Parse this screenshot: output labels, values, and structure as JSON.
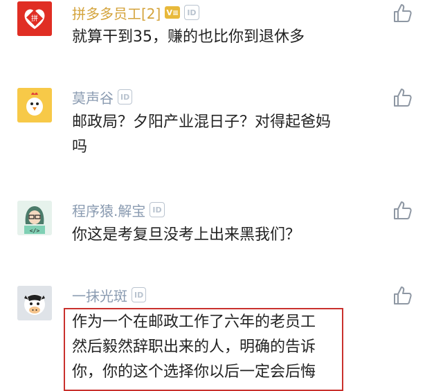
{
  "comments": [
    {
      "username": "拼多多员工[2]",
      "vip_badge": "V≡",
      "id_badge": "ID",
      "avatar_icon": "pinduoduo-logo-icon",
      "text_lines": [
        "就算干到35，赚的也比你到退休多"
      ]
    },
    {
      "username": "莫声谷",
      "id_badge": "ID",
      "avatar_icon": "chicken-avatar-icon",
      "text_lines": [
        "邮政局？夕阳产业混日子？对得起爸妈",
        "吗"
      ]
    },
    {
      "username": "程序猿.解宝",
      "id_badge": "ID",
      "avatar_icon": "programmer-avatar-icon",
      "text_lines": [
        "你这是考复旦没考上出来黑我们？"
      ]
    },
    {
      "username": "一抹光斑",
      "id_badge": "ID",
      "avatar_icon": "cow-avatar-icon",
      "text_lines": [
        "作为一个在邮政工作了六年的老员工",
        "然后毅然辞职出来的人，明确的告诉",
        "你，你的这个选择你以后一定会后悔"
      ]
    }
  ],
  "like_icon": "thumbs-up-icon",
  "colors": {
    "username": "#8a9bb1",
    "username_highlight": "#d4a33b",
    "highlight_border": "#c9302c"
  }
}
